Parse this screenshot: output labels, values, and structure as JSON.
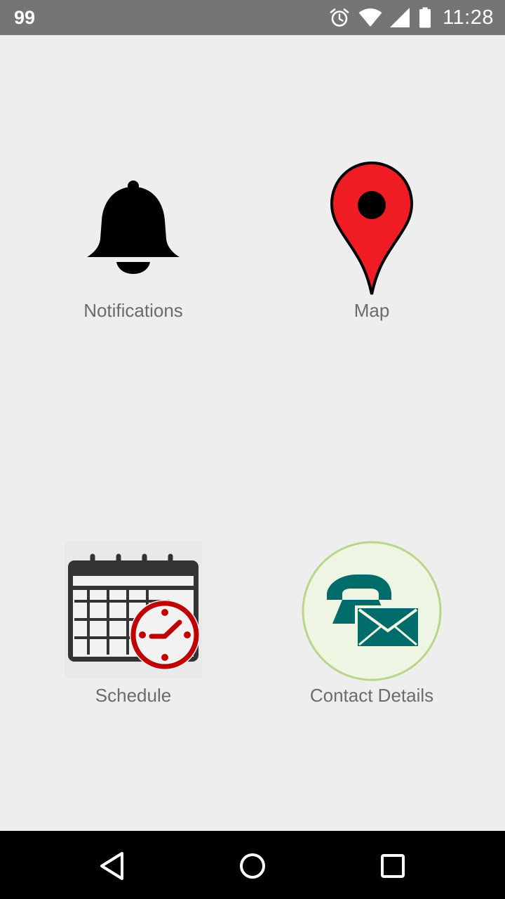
{
  "status_bar": {
    "notification_count": "99",
    "time": "11:28",
    "icons": [
      "alarm-icon",
      "wifi-icon",
      "signal-icon",
      "battery-icon"
    ]
  },
  "tiles": [
    {
      "label": "Notifications",
      "icon": "bell-icon"
    },
    {
      "label": "Map",
      "icon": "map-pin-icon"
    },
    {
      "label": "Schedule",
      "icon": "calendar-clock-icon"
    },
    {
      "label": "Contact Details",
      "icon": "phone-mail-icon"
    }
  ],
  "nav_bar": {
    "icons": [
      "back-icon",
      "home-icon",
      "recents-icon"
    ]
  },
  "colors": {
    "status_bar": "#757575",
    "background": "#eeeeee",
    "label_text": "#6b6b6b",
    "pin_red": "#ef1c24",
    "clock_red": "#c00000",
    "contact_teal": "#006b6b",
    "contact_circle": "#eef5e2",
    "contact_ring": "#b7d68a"
  }
}
